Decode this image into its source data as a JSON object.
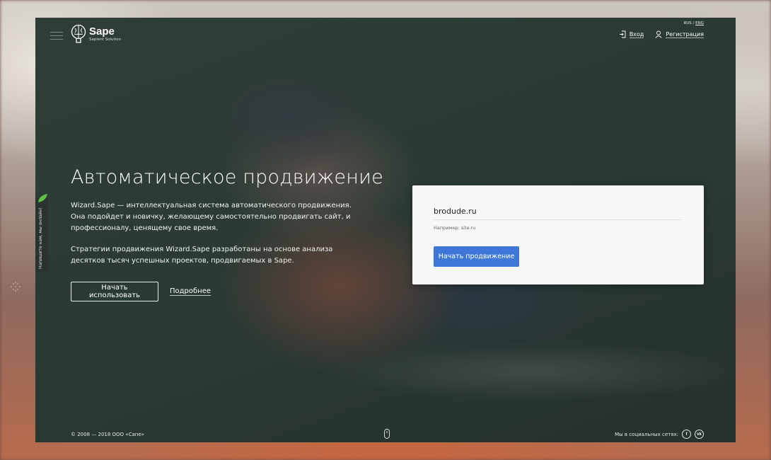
{
  "brand": {
    "name": "Sape",
    "subtitle": "Sapient Solution"
  },
  "lang": {
    "ru": "RUS",
    "sep": "/",
    "en": "ENG"
  },
  "auth": {
    "login": "Вход",
    "register": "Регистрация"
  },
  "hero": {
    "title": "Автоматическое продвижение",
    "desc1": "Wizard.Sape — интеллектуальная система автоматического продвижения. Она подойдет и новичку, желающему самостоятельно продвигать сайт, и профессионалу, ценящему свое время.",
    "desc2": "Стратегии продвижения Wizard.Sape разработаны на основе анализа десятков тысяч успешных проектов, продвигаемых в Sape.",
    "start_button": "Начать использовать",
    "more_link": "Подробнее"
  },
  "form": {
    "site_value": "brodude.ru",
    "example": "Например: site.ru",
    "submit": "Начать продвижение"
  },
  "chat": {
    "label": "Напишите нам, мы онлайн!"
  },
  "footer": {
    "copyright": "© 2008 — 2018 ООО «Сапе»",
    "social_label": "Мы в социальных сетях:",
    "facebook": "f",
    "vk": "vk"
  },
  "colors": {
    "primary": "#3d78d8",
    "overlay": "#2f4139",
    "card": "#f7f7f7"
  }
}
